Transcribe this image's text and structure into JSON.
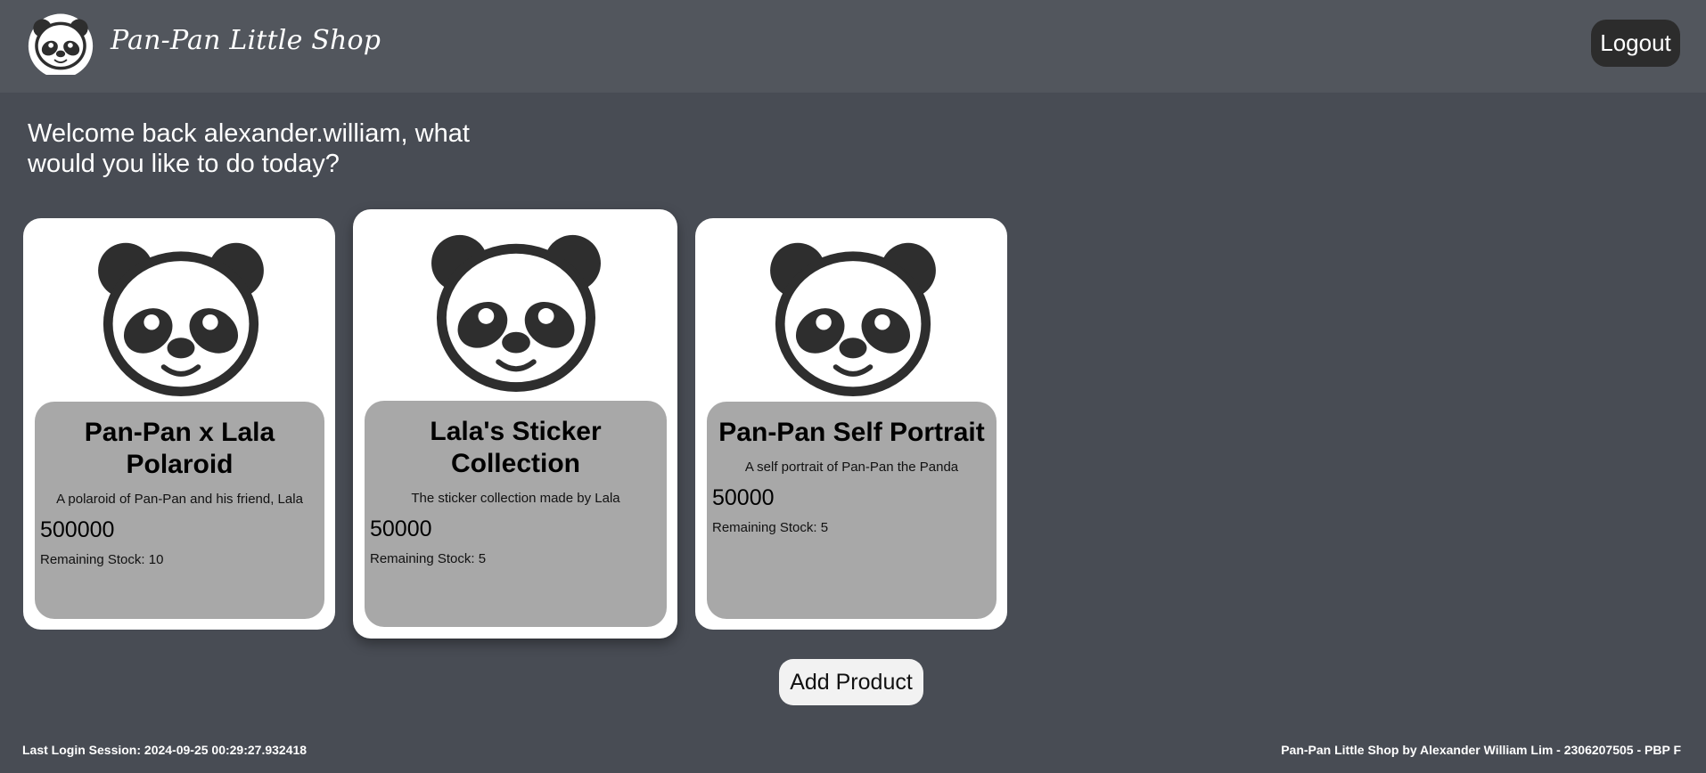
{
  "header": {
    "brand": "Pan-Pan Little Shop",
    "logout_label": "Logout",
    "logo_icon": "panda-icon"
  },
  "welcome": {
    "text": "Welcome back alexander.william, what would you like to do today?"
  },
  "products": [
    {
      "name": "Pan-Pan x Lala Polaroid",
      "description": "A polaroid of Pan-Pan and his friend, Lala",
      "price": "500000",
      "stock": "Remaining Stock: 10",
      "icon": "panda-icon"
    },
    {
      "name": "Lala's Sticker Collection",
      "description": "The sticker collection made by Lala",
      "price": "50000",
      "stock": "Remaining Stock: 5",
      "icon": "panda-icon"
    },
    {
      "name": "Pan-Pan Self Portrait",
      "description": "A self portrait of Pan-Pan the Panda",
      "price": "50000",
      "stock": "Remaining Stock: 5",
      "icon": "panda-icon"
    }
  ],
  "actions": {
    "add_product_label": "Add Product"
  },
  "footer": {
    "last_login": "Last Login Session: 2024-09-25 00:29:27.932418",
    "credits": "Pan-Pan Little Shop by Alexander William Lim - 2306207505 - PBP F"
  },
  "colors": {
    "background": "#484c54",
    "navbar": "#52565d",
    "card": "#ffffff",
    "card_info": "#a8a8a8",
    "logout_button": "#2c2c2c",
    "add_button": "#f2f2f2"
  }
}
